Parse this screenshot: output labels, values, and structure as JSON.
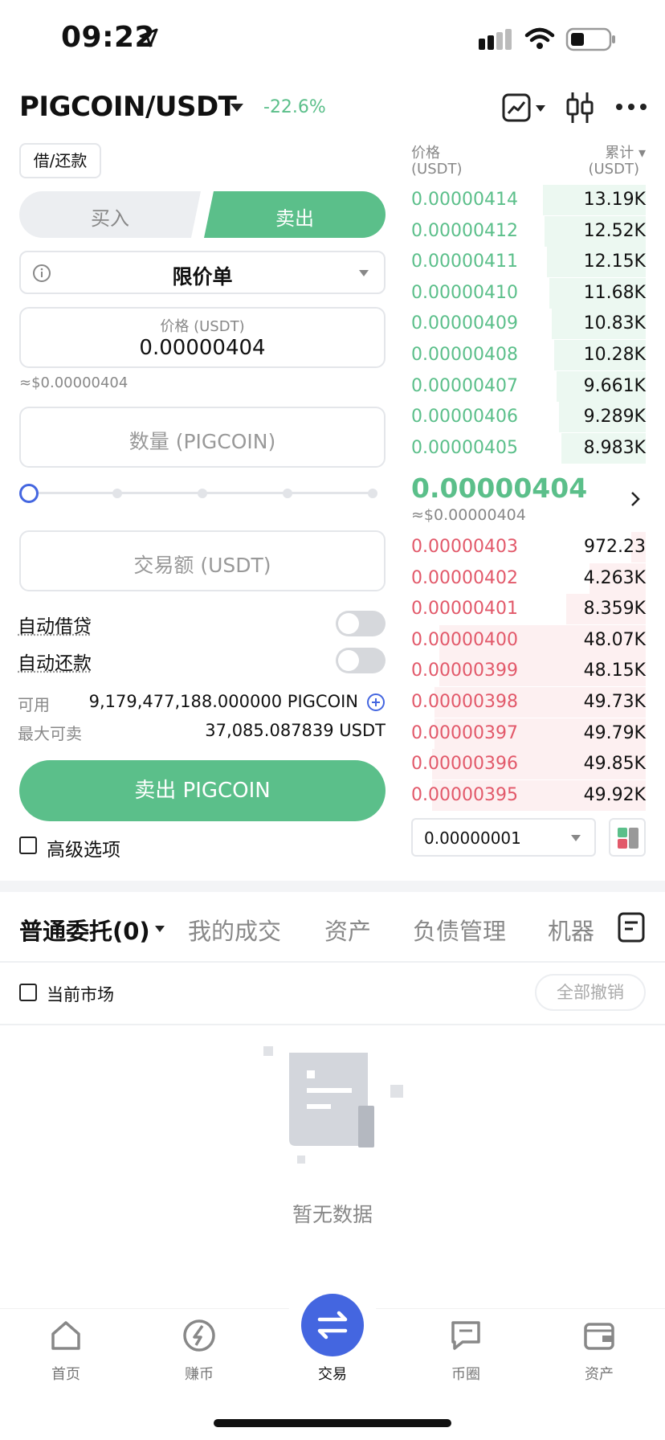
{
  "status": {
    "time": "09:22"
  },
  "header": {
    "pair": "PIGCOIN/USDT",
    "change": "-22.6%"
  },
  "left": {
    "borrow_repay": "借/还款",
    "buy_tab": "买入",
    "sell_tab": "卖出",
    "order_type": "限价单",
    "price_label": "价格 (USDT)",
    "price_value": "0.00000404",
    "price_approx": "≈$0.00000404",
    "amount_placeholder": "数量 (PIGCOIN)",
    "total_placeholder": "交易额 (USDT)",
    "auto_borrow": "自动借贷",
    "auto_repay": "自动还款",
    "available_label": "可用",
    "available_value": "9,179,477,188.000000 PIGCOIN",
    "max_sell_label": "最大可卖",
    "max_sell_value": "37,085.087839 USDT",
    "sell_button": "卖出 PIGCOIN",
    "advanced": "高级选项"
  },
  "orderbook": {
    "price_header": "价格",
    "price_unit": "(USDT)",
    "cum_header": "累计 ▾",
    "cum_unit": "(USDT)",
    "asks": [
      {
        "price": "0.00000414",
        "qty": "13.19K",
        "depth": 0.44
      },
      {
        "price": "0.00000412",
        "qty": "12.52K",
        "depth": 0.43
      },
      {
        "price": "0.00000411",
        "qty": "12.15K",
        "depth": 0.42
      },
      {
        "price": "0.00000410",
        "qty": "11.68K",
        "depth": 0.41
      },
      {
        "price": "0.00000409",
        "qty": "10.83K",
        "depth": 0.4
      },
      {
        "price": "0.00000408",
        "qty": "10.28K",
        "depth": 0.39
      },
      {
        "price": "0.00000407",
        "qty": "9.661K",
        "depth": 0.38
      },
      {
        "price": "0.00000406",
        "qty": "9.289K",
        "depth": 0.37
      },
      {
        "price": "0.00000405",
        "qty": "8.983K",
        "depth": 0.36
      }
    ],
    "last_price": "0.00000404",
    "last_approx": "≈$0.00000404",
    "bids": [
      {
        "price": "0.00000403",
        "qty": "972.23",
        "depth": 0.06
      },
      {
        "price": "0.00000402",
        "qty": "4.263K",
        "depth": 0.24
      },
      {
        "price": "0.00000401",
        "qty": "8.359K",
        "depth": 0.34
      },
      {
        "price": "0.00000400",
        "qty": "48.07K",
        "depth": 0.88
      },
      {
        "price": "0.00000399",
        "qty": "48.15K",
        "depth": 0.88
      },
      {
        "price": "0.00000398",
        "qty": "49.73K",
        "depth": 0.9
      },
      {
        "price": "0.00000397",
        "qty": "49.79K",
        "depth": 0.9
      },
      {
        "price": "0.00000396",
        "qty": "49.85K",
        "depth": 0.91
      },
      {
        "price": "0.00000395",
        "qty": "49.92K",
        "depth": 0.91
      }
    ],
    "precision": "0.00000001"
  },
  "orders": {
    "tabs": [
      "普通委托(0)",
      "我的成交",
      "资产",
      "负债管理",
      "机器"
    ],
    "current_market": "当前市场",
    "cancel_all": "全部撤销",
    "empty": "暂无数据"
  },
  "nav": {
    "home": "首页",
    "earn": "赚币",
    "trade": "交易",
    "feed": "币圈",
    "assets": "资产"
  },
  "colors": {
    "green": "#5bbf8a",
    "red": "#e2596a",
    "accent": "#4466e0"
  }
}
